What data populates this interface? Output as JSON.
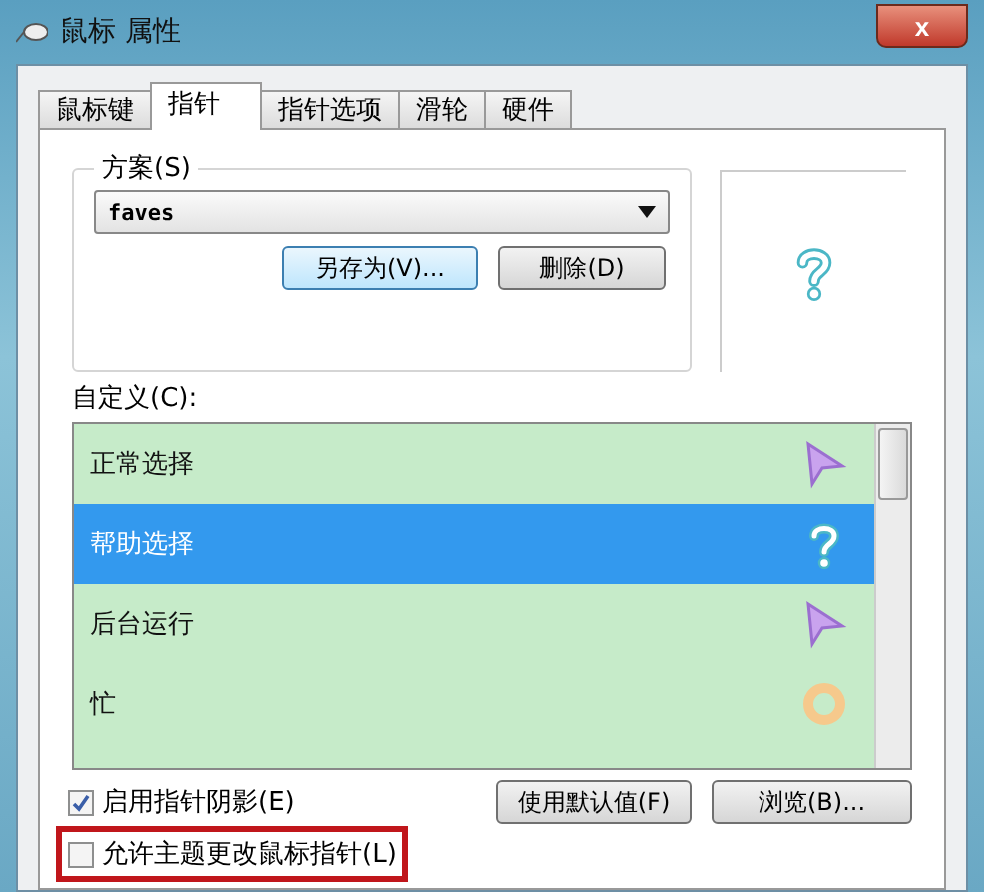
{
  "window": {
    "title": "鼠标 属性",
    "close": "x"
  },
  "tabs": [
    {
      "label": "鼠标键",
      "selected": false
    },
    {
      "label": "指针",
      "selected": true
    },
    {
      "label": "指针选项",
      "selected": false
    },
    {
      "label": "滑轮",
      "selected": false
    },
    {
      "label": "硬件",
      "selected": false
    }
  ],
  "scheme": {
    "label": "方案(S)",
    "value": "faves",
    "buttons": [
      {
        "label": "另存为(V)...",
        "focused": true
      },
      {
        "label": "删除(D)",
        "focused": false
      }
    ]
  },
  "preview": {
    "kind": "help"
  },
  "custom": {
    "label": "自定义(C):",
    "rows": [
      {
        "label": "正常选择",
        "kind": "arrow",
        "selected": false
      },
      {
        "label": "帮助选择",
        "kind": "help",
        "selected": true
      },
      {
        "label": "后台运行",
        "kind": "arrow",
        "selected": false
      },
      {
        "label": "忙",
        "kind": "busy",
        "selected": false
      }
    ]
  },
  "options": [
    {
      "label": "启用指针阴影(E)",
      "checked": true,
      "highlighted": false
    },
    {
      "label": "允许主题更改鼠标指针(L)",
      "checked": false,
      "highlighted": true
    }
  ],
  "actions": [
    {
      "label": "使用默认值(F)"
    },
    {
      "label": "浏览(B)..."
    }
  ]
}
